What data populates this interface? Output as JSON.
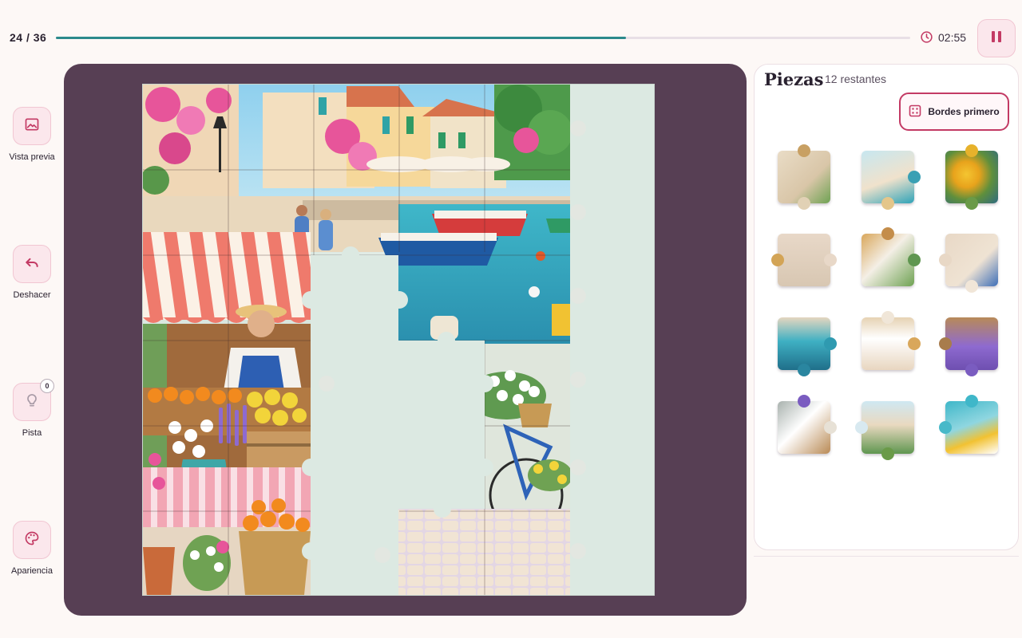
{
  "progress": {
    "text": "24 / 36",
    "placed": 24,
    "total": 36,
    "fraction": 0.667
  },
  "timer": {
    "value": "02:55",
    "icon": "clock-icon"
  },
  "pause": {
    "icon": "pause-icon"
  },
  "tools": {
    "preview": {
      "label": "Vista previa",
      "icon": "image-icon"
    },
    "undo": {
      "label": "Deshacer",
      "icon": "undo-icon"
    },
    "hint": {
      "label": "Pista",
      "icon": "lightbulb-icon",
      "badge": "0"
    },
    "appearance": {
      "label": "Apariencia",
      "icon": "palette-icon"
    }
  },
  "sidebar": {
    "title": "Piezas",
    "remaining": "12 restantes",
    "edges_button": "Bordes primero",
    "edges_icon": "grid-icon",
    "pieces_count": 12
  },
  "colors": {
    "accent": "#c33a64",
    "progress": "#2b8a8c",
    "board": "#573f54",
    "button_bg": "#fbe7ec"
  }
}
